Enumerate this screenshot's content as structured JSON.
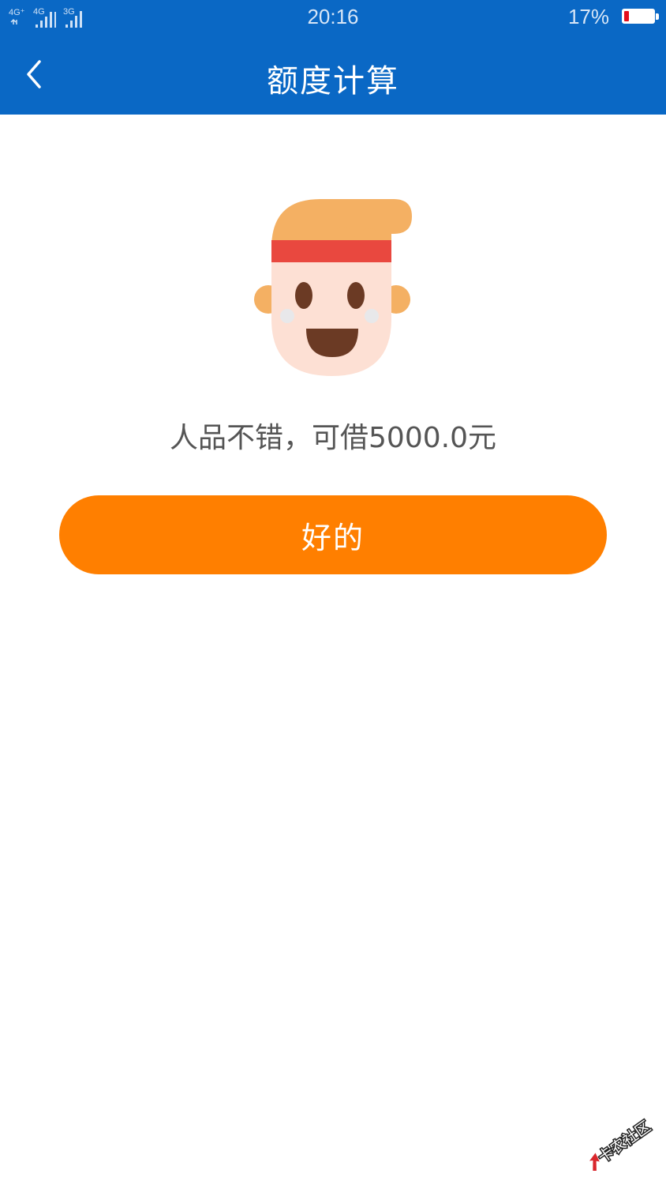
{
  "status_bar": {
    "network_1": "4G⁺",
    "network_2": "4G",
    "network_3": "3G",
    "time": "20:16",
    "battery_percent_text": "17%",
    "battery_level": 0.17
  },
  "nav": {
    "back_icon": "chevron-left-icon",
    "title": "额度计算"
  },
  "result": {
    "avatar_icon": "smiling-boy-face-icon",
    "message": "人品不错，可借5000.0元"
  },
  "actions": {
    "ok_label": "好的"
  },
  "watermark": {
    "text": "卡农社区"
  },
  "colors": {
    "header_blue": "#0a68c5",
    "button_orange": "#ff7f00",
    "battery_low": "#e5101c"
  }
}
